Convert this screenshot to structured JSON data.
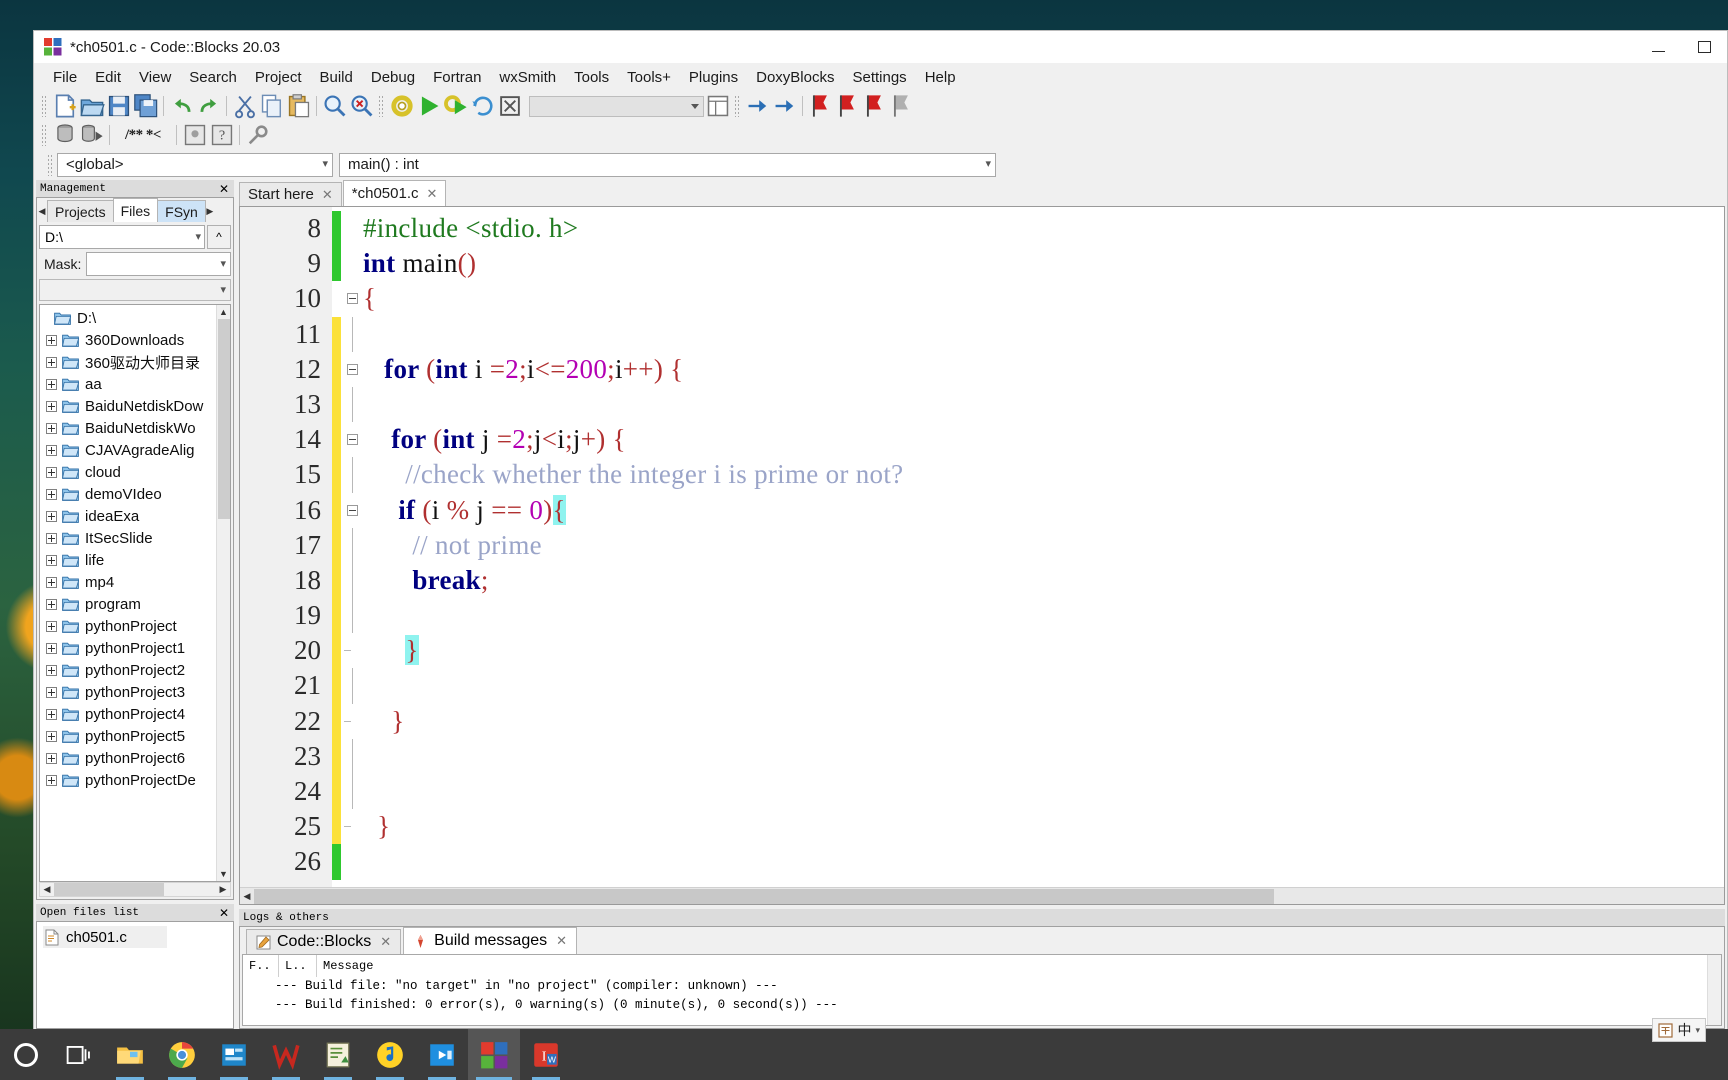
{
  "window": {
    "title": "*ch0501.c - Code::Blocks 20.03",
    "icon": "codeblocks-icon",
    "minimize_label": "—",
    "maximize_label": "▭"
  },
  "menubar": {
    "items": [
      "File",
      "Edit",
      "View",
      "Search",
      "Project",
      "Build",
      "Debug",
      "Fortran",
      "wxSmith",
      "Tools",
      "Tools+",
      "Plugins",
      "DoxyBlocks",
      "Settings",
      "Help"
    ]
  },
  "toolbar_main": {
    "buttons": [
      "new-file-icon",
      "open-file-icon",
      "save-icon",
      "save-all-icon",
      "undo-icon",
      "redo-icon",
      "cut-icon",
      "copy-icon",
      "paste-icon",
      "find-icon",
      "replace-icon"
    ],
    "build_buttons": [
      "build-icon",
      "run-icon",
      "build-and-run-icon",
      "rebuild-icon",
      "abort-icon"
    ],
    "target_combo_value": "",
    "debug_buttons": [
      "debug-windows-icon",
      "debug-step-icon",
      "breakpoint-icon",
      "breakpoint-next-icon",
      "breakpoint-stop-icon",
      "breakpoint-clear-icon"
    ]
  },
  "toolbar_doxy": {
    "buttons": [
      "doxyblocks-extract-icon",
      "doxyblocks-run-icon"
    ],
    "comment_label": "/** *<",
    "extra_buttons": [
      "doxyblocks-wizard-icon",
      "doxyblocks-help-icon",
      "doxyblocks-config-icon"
    ]
  },
  "scopebar": {
    "scope_value": "<global>",
    "function_value": "main() : int"
  },
  "management": {
    "panel_title": "Management",
    "close_label": "✕",
    "tabs": [
      {
        "label": "Projects",
        "selected": false
      },
      {
        "label": "Files",
        "selected": true
      },
      {
        "label": "FSyn",
        "selected": false,
        "highlight": true
      }
    ],
    "path_value": "D:\\",
    "up_label": "^",
    "mask_label": "Mask:",
    "mask_value": "",
    "wildcard_value": "",
    "tree": [
      {
        "label": "D:\\",
        "root": true
      },
      {
        "label": "360Downloads",
        "root": false
      },
      {
        "label": "360驱动大师目录",
        "root": false
      },
      {
        "label": "aa",
        "root": false
      },
      {
        "label": "BaiduNetdiskDow",
        "root": false
      },
      {
        "label": "BaiduNetdiskWo",
        "root": false
      },
      {
        "label": "CJAVAgradeAlig",
        "root": false
      },
      {
        "label": "cloud",
        "root": false
      },
      {
        "label": "demoVIdeo",
        "root": false
      },
      {
        "label": "ideaExa",
        "root": false
      },
      {
        "label": "ItSecSlide",
        "root": false
      },
      {
        "label": "life",
        "root": false
      },
      {
        "label": "mp4",
        "root": false
      },
      {
        "label": "program",
        "root": false
      },
      {
        "label": "pythonProject",
        "root": false
      },
      {
        "label": "pythonProject1",
        "root": false
      },
      {
        "label": "pythonProject2",
        "root": false
      },
      {
        "label": "pythonProject3",
        "root": false
      },
      {
        "label": "pythonProject4",
        "root": false
      },
      {
        "label": "pythonProject5",
        "root": false
      },
      {
        "label": "pythonProject6",
        "root": false
      },
      {
        "label": "pythonProjectDe",
        "root": false
      }
    ]
  },
  "open_files": {
    "panel_title": "Open files list",
    "close_label": "✕",
    "files": [
      {
        "label": "ch0501.c",
        "icon": "c-file-icon"
      }
    ]
  },
  "editor": {
    "tabs": [
      {
        "label": "Start here",
        "close": "✕",
        "selected": false
      },
      {
        "label": "*ch0501.c",
        "close": "✕",
        "selected": true
      }
    ],
    "first_line_number": 8,
    "lines": [
      {
        "num": 8,
        "marker": "green",
        "fold": "none",
        "tokens": [
          {
            "t": "#include <stdio. h>",
            "c": "pp"
          }
        ]
      },
      {
        "num": 9,
        "marker": "green",
        "fold": "none",
        "tokens": [
          {
            "t": "int",
            "c": "k"
          },
          {
            "t": " main",
            "c": ""
          },
          {
            "t": "()",
            "c": "op"
          }
        ]
      },
      {
        "num": 10,
        "marker": "none",
        "fold": "box",
        "tokens": [
          {
            "t": "{",
            "c": "op"
          }
        ]
      },
      {
        "num": 11,
        "marker": "yellow",
        "fold": "line",
        "tokens": []
      },
      {
        "num": 12,
        "marker": "yellow",
        "fold": "box",
        "tokens": [
          {
            "t": "   for ",
            "c": "k"
          },
          {
            "t": "(",
            "c": "op"
          },
          {
            "t": "int",
            "c": "k"
          },
          {
            "t": " i ",
            "c": ""
          },
          {
            "t": "=",
            "c": "op"
          },
          {
            "t": "2",
            "c": "num"
          },
          {
            "t": ";",
            "c": "op"
          },
          {
            "t": "i",
            "c": ""
          },
          {
            "t": "<=",
            "c": "op"
          },
          {
            "t": "200",
            "c": "num"
          },
          {
            "t": ";",
            "c": "op"
          },
          {
            "t": "i",
            "c": ""
          },
          {
            "t": "++",
            "c": "op"
          },
          {
            "t": ") {",
            "c": "op"
          }
        ]
      },
      {
        "num": 13,
        "marker": "yellow",
        "fold": "line",
        "tokens": []
      },
      {
        "num": 14,
        "marker": "yellow",
        "fold": "box",
        "tokens": [
          {
            "t": "    for ",
            "c": "k"
          },
          {
            "t": "(",
            "c": "op"
          },
          {
            "t": "int",
            "c": "k"
          },
          {
            "t": " j ",
            "c": ""
          },
          {
            "t": "=",
            "c": "op"
          },
          {
            "t": "2",
            "c": "num"
          },
          {
            "t": ";",
            "c": "op"
          },
          {
            "t": "j",
            "c": ""
          },
          {
            "t": "<",
            "c": "op"
          },
          {
            "t": "i",
            "c": ""
          },
          {
            "t": ";",
            "c": "op"
          },
          {
            "t": "j",
            "c": ""
          },
          {
            "t": "+",
            "c": "op"
          },
          {
            "t": ") {",
            "c": "op"
          }
        ]
      },
      {
        "num": 15,
        "marker": "yellow",
        "fold": "line",
        "tokens": [
          {
            "t": "      //check whether the integer i is prime or not?",
            "c": "cm"
          }
        ]
      },
      {
        "num": 16,
        "marker": "yellow",
        "fold": "box",
        "tokens": [
          {
            "t": "     if ",
            "c": "k"
          },
          {
            "t": "(",
            "c": "op"
          },
          {
            "t": "i ",
            "c": ""
          },
          {
            "t": "%",
            "c": "op"
          },
          {
            "t": " j ",
            "c": ""
          },
          {
            "t": "==",
            "c": "op"
          },
          {
            "t": " ",
            "c": ""
          },
          {
            "t": "0",
            "c": "num"
          },
          {
            "t": ")",
            "c": "op"
          },
          {
            "t": "{",
            "c": "op brace-hl"
          }
        ]
      },
      {
        "num": 17,
        "marker": "yellow",
        "fold": "line",
        "tokens": [
          {
            "t": "       // not prime",
            "c": "cm"
          }
        ]
      },
      {
        "num": 18,
        "marker": "yellow",
        "fold": "line",
        "tokens": [
          {
            "t": "       break",
            "c": "k"
          },
          {
            "t": ";",
            "c": "op"
          }
        ]
      },
      {
        "num": 19,
        "marker": "yellow",
        "fold": "line",
        "tokens": []
      },
      {
        "num": 20,
        "marker": "yellow",
        "fold": "dash",
        "tokens": [
          {
            "t": "      ",
            "c": ""
          },
          {
            "t": "}",
            "c": "op brace-hl"
          }
        ]
      },
      {
        "num": 21,
        "marker": "yellow",
        "fold": "line",
        "tokens": []
      },
      {
        "num": 22,
        "marker": "yellow",
        "fold": "dash",
        "tokens": [
          {
            "t": "    }",
            "c": "op"
          }
        ]
      },
      {
        "num": 23,
        "marker": "yellow",
        "fold": "line",
        "tokens": []
      },
      {
        "num": 24,
        "marker": "yellow",
        "fold": "line",
        "tokens": []
      },
      {
        "num": 25,
        "marker": "yellow",
        "fold": "dash",
        "tokens": [
          {
            "t": "  }",
            "c": "op"
          }
        ]
      },
      {
        "num": 26,
        "marker": "green",
        "fold": "none",
        "tokens": []
      }
    ],
    "colors": {
      "preprocessor": "#1f7a1f",
      "keyword": "#000080",
      "number": "#b300b3",
      "operator": "#b03030",
      "comment": "#9aa4c8",
      "brace_match_bg": "#8ff3ef",
      "modified_marker": "#fbe13a",
      "saved_marker": "#2ec82e"
    }
  },
  "logs": {
    "panel_title": "Logs & others",
    "tabs": [
      {
        "label": "Code::Blocks",
        "icon": "codeblocks-log-icon",
        "close": "✕",
        "selected": false
      },
      {
        "label": "Build messages",
        "icon": "build-messages-icon",
        "close": "✕",
        "selected": true
      }
    ],
    "columns": [
      "F..",
      "L..",
      "Message"
    ],
    "messages": [
      "--- Build file: \"no target\" in \"no project\" (compiler: unknown) ---",
      "--- Build finished: 0 error(s), 0 warning(s) (0 minute(s), 0 second(s)) ---"
    ]
  },
  "taskbar": {
    "items": [
      {
        "name": "cortana-icon",
        "label": "Cortana"
      },
      {
        "name": "task-view-icon",
        "label": "Task View"
      },
      {
        "name": "file-explorer-icon",
        "label": "File Explorer"
      },
      {
        "name": "chrome-icon",
        "label": "Google Chrome"
      },
      {
        "name": "wps-presentation-icon",
        "label": "WPS Presentation"
      },
      {
        "name": "wps-office-icon",
        "label": "WPS Office"
      },
      {
        "name": "notepad-plus-icon",
        "label": "Notepad++"
      },
      {
        "name": "kugou-icon",
        "label": "Kugou Music"
      },
      {
        "name": "video-player-icon",
        "label": "Video Player"
      },
      {
        "name": "codeblocks-icon",
        "label": "Code::Blocks"
      },
      {
        "name": "wps-writer-icon",
        "label": "WPS Writer"
      }
    ],
    "tray": {
      "ime_label": "中",
      "ime_icon": "ime-icon"
    }
  }
}
